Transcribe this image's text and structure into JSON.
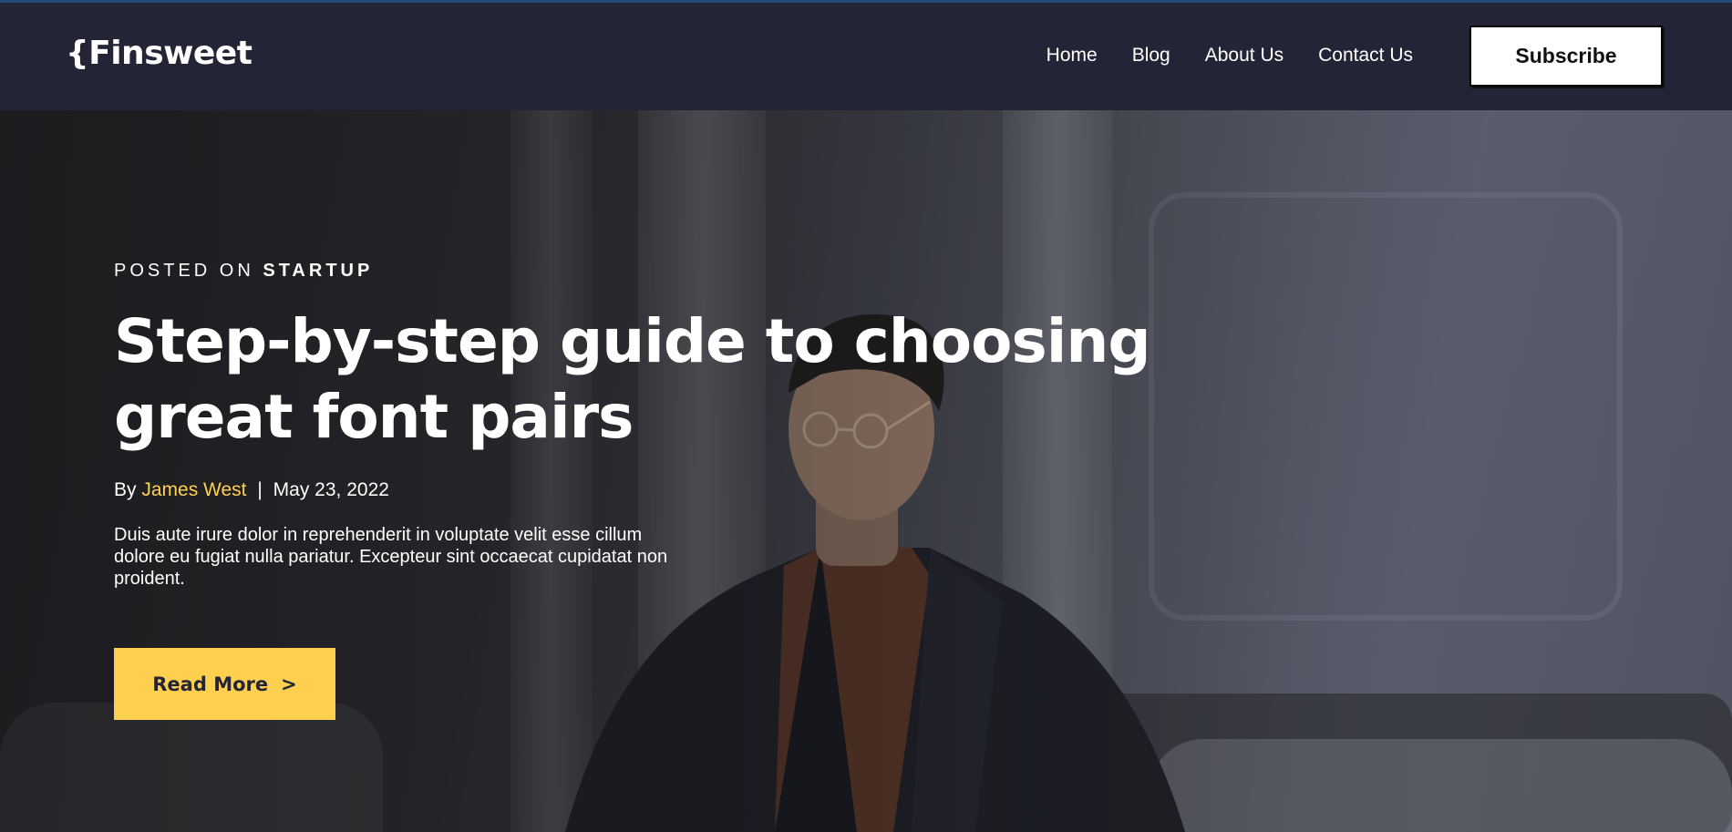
{
  "header": {
    "logo": "{Finsweet",
    "nav": [
      {
        "label": "Home"
      },
      {
        "label": "Blog"
      },
      {
        "label": "About Us"
      },
      {
        "label": "Contact Us"
      }
    ],
    "subscribe_label": "Subscribe"
  },
  "hero": {
    "posted_prefix": "POSTED ON",
    "category": "STARTUP",
    "title": "Step-by-step guide to choosing great font pairs",
    "by_label": "By",
    "author": "James West",
    "separator": "|",
    "date": "May 23, 2022",
    "excerpt": "Duis aute irure dolor in reprehenderit in voluptate velit esse cillum dolore eu fugiat nulla pariatur. Excepteur sint occaecat cupidatat non proident.",
    "read_more_label": "Read More",
    "read_more_icon": ">"
  },
  "colors": {
    "header_bg": "#232536",
    "accent": "#ffd050",
    "text": "#ffffff"
  }
}
